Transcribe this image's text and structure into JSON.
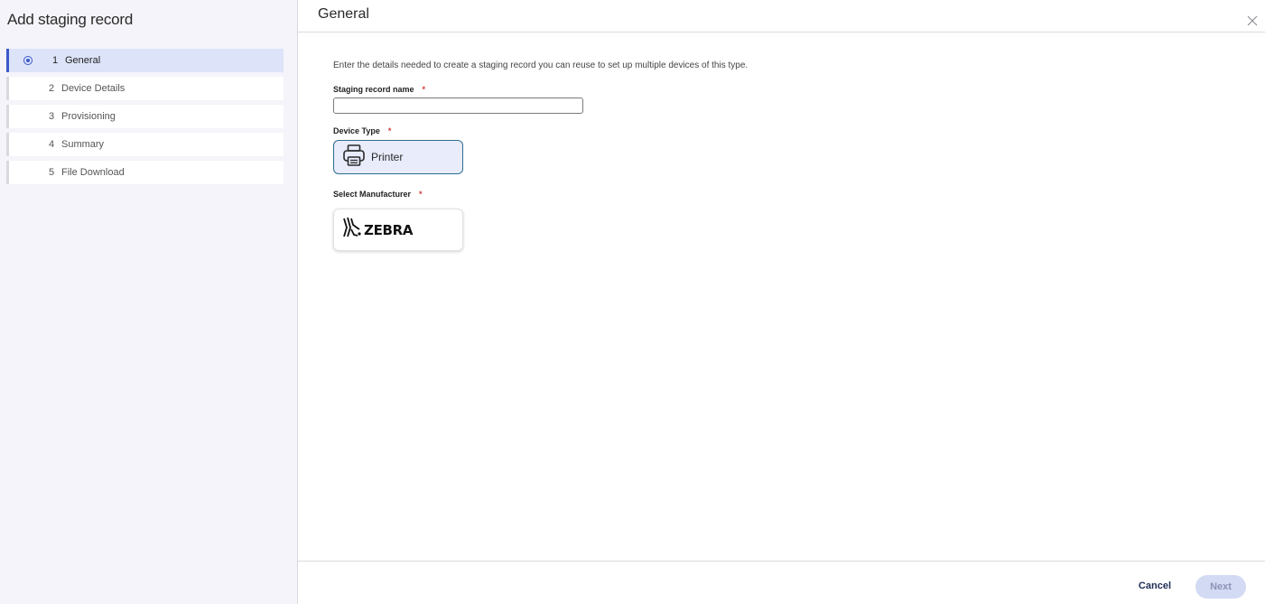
{
  "sidebar": {
    "title": "Add staging record",
    "steps": [
      {
        "num": "1",
        "label": "General",
        "active": true
      },
      {
        "num": "2",
        "label": "Device Details"
      },
      {
        "num": "3",
        "label": "Provisioning"
      },
      {
        "num": "4",
        "label": "Summary"
      },
      {
        "num": "5",
        "label": "File Download"
      }
    ]
  },
  "header": {
    "title": "General",
    "close_icon": "close-icon"
  },
  "form": {
    "description": "Enter the details needed to create a staging record you can reuse to set up multiple devices of this type.",
    "name_label": "Staging record name",
    "name_value": "",
    "required_mark": "*",
    "device_type_label": "Device Type",
    "device_type_option": "Printer",
    "device_type_icon": "printer-icon",
    "manufacturer_label": "Select Manufacturer",
    "manufacturer_option": "ZEBRA",
    "manufacturer_icon": "zebra-logo"
  },
  "footer": {
    "cancel_label": "Cancel",
    "next_label": "Next"
  },
  "colors": {
    "accent": "#3a59c9",
    "active_step_bg": "#dde3f8",
    "required": "#d23a3a",
    "next_disabled_bg": "#d3daf3"
  }
}
